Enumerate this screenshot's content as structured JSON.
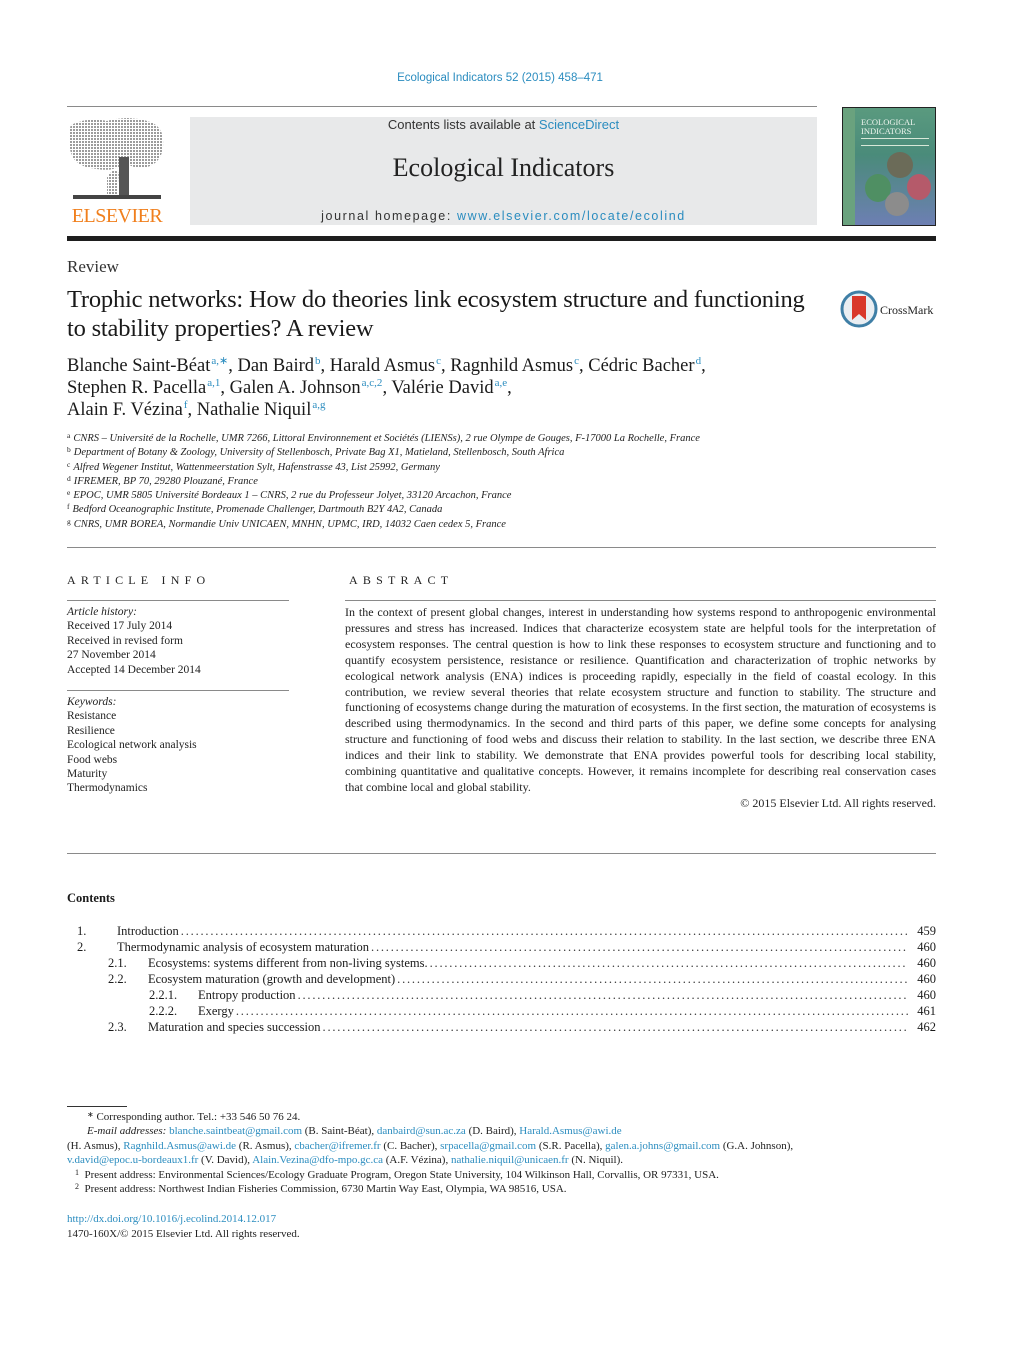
{
  "citation": "Ecological Indicators 52 (2015) 458–471",
  "publisher": {
    "name": "ELSEVIER",
    "brand_color": "#f07f1d"
  },
  "masthead": {
    "contents_prefix": "Contents lists available at ",
    "contents_link": "ScienceDirect",
    "journal_title": "Ecological Indicators",
    "homepage_prefix": "journal homepage: ",
    "homepage_link": "www.elsevier.com/locate/ecolind"
  },
  "cover": {
    "title_line1": "ECOLOGICAL",
    "title_line2": "INDICATORS"
  },
  "crossmark": {
    "label": "CrossMark"
  },
  "article": {
    "type": "Review",
    "title": "Trophic networks: How do theories link ecosystem structure and functioning to stability properties? A review",
    "authors": [
      {
        "name": "Blanche Saint-Béat",
        "sup": "a,∗",
        "sep": ", "
      },
      {
        "name": "Dan Baird",
        "sup": "b",
        "sep": ", "
      },
      {
        "name": "Harald Asmus",
        "sup": "c",
        "sep": ", "
      },
      {
        "name": "Ragnhild Asmus",
        "sup": "c",
        "sep": ", "
      },
      {
        "name": "Cédric Bacher",
        "sup": "d",
        "sep": ","
      },
      {
        "name": "Stephen R. Pacella",
        "sup": "a,1",
        "sep": ", "
      },
      {
        "name": "Galen A. Johnson",
        "sup": "a,c,2",
        "sep": ", "
      },
      {
        "name": "Valérie David",
        "sup": "a,e",
        "sep": ","
      },
      {
        "name": "Alain F. Vézina",
        "sup": "f",
        "sep": ", "
      },
      {
        "name": "Nathalie Niquil",
        "sup": "a,g",
        "sep": ""
      }
    ],
    "affiliations": [
      {
        "key": "a",
        "text": "CNRS – Université de la Rochelle, UMR 7266, Littoral Environnement et Sociétés (LIENSs), 2 rue Olympe de Gouges, F-17000 La Rochelle, France"
      },
      {
        "key": "b",
        "text": "Department of Botany & Zoology, University of Stellenbosch, Private Bag X1, Matieland, Stellenbosch, South Africa"
      },
      {
        "key": "c",
        "text": "Alfred Wegener Institut, Wattenmeerstation Sylt, Hafenstrasse 43, List 25992, Germany"
      },
      {
        "key": "d",
        "text": "IFREMER, BP 70, 29280 Plouzané, France"
      },
      {
        "key": "e",
        "text": "EPOC, UMR 5805 Université Bordeaux 1 – CNRS, 2 rue du Professeur Jolyet, 33120 Arcachon, France"
      },
      {
        "key": "f",
        "text": "Bedford Oceanographic Institute, Promenade Challenger, Dartmouth B2Y 4A2, Canada"
      },
      {
        "key": "g",
        "text": "CNRS, UMR BOREA, Normandie Univ UNICAEN, MNHN, UPMC, IRD, 14032 Caen cedex 5, France"
      }
    ]
  },
  "article_info": {
    "heading": "ARTICLE INFO",
    "history_label": "Article history:",
    "history": [
      "Received 17 July 2014",
      "Received in revised form",
      "27 November 2014",
      "Accepted 14 December 2014"
    ],
    "keywords_label": "Keywords:",
    "keywords": [
      "Resistance",
      "Resilience",
      "Ecological network analysis",
      "Food webs",
      "Maturity",
      "Thermodynamics"
    ]
  },
  "abstract": {
    "heading": "ABSTRACT",
    "text": "In the context of present global changes, interest in understanding how systems respond to anthropogenic environmental pressures and stress has increased. Indices that characterize ecosystem state are helpful tools for the interpretation of ecosystem responses. The central question is how to link these responses to ecosystem structure and functioning and to quantify ecosystem persistence, resistance or resilience. Quantification and characterization of trophic networks by ecological network analysis (ENA) indices is proceeding rapidly, especially in the field of coastal ecology. In this contribution, we review several theories that relate ecosystem structure and function to stability. The structure and functioning of ecosys­tems change during the maturation of ecosystems. In the first section, the maturation of ecosystems is described using thermodynamics. In the second and third parts of this paper, we define some concepts for analysing structure and functioning of food webs and discuss their relation to stability. In the last section, we describe three ENA indices and their link to stability. We demonstrate that ENA provides powerful tools for describing local stability, combining quantitative and qualitative concepts. However, it remains incomplete for describing real conservation cases that combine local and global stability.",
    "copyright": "© 2015 Elsevier Ltd. All rights reserved."
  },
  "contents": {
    "heading": "Contents",
    "items": [
      {
        "level": 1,
        "num": "1.",
        "label": "Introduction",
        "page": "459"
      },
      {
        "level": 1,
        "num": "2.",
        "label": "Thermodynamic analysis of ecosystem maturation",
        "page": "460"
      },
      {
        "level": 2,
        "num": "2.1.",
        "label": "Ecosystems: systems different from non-living systems.",
        "page": "460"
      },
      {
        "level": 2,
        "num": "2.2.",
        "label": "Ecosystem maturation (growth and development)",
        "page": "460"
      },
      {
        "level": 3,
        "num": "2.2.1.",
        "label": "Entropy production",
        "page": "460"
      },
      {
        "level": 3,
        "num": "2.2.2.",
        "label": "Exergy",
        "page": "461"
      },
      {
        "level": 2,
        "num": "2.3.",
        "label": "Maturation and species succession",
        "page": "462"
      }
    ]
  },
  "footnotes": {
    "corresponding_mark": "∗",
    "corresponding": "Corresponding author. Tel.: +33 546 50 76 24.",
    "email_label": "E-mail addresses:",
    "emails": [
      {
        "email": "blanche.saintbeat@gmail.com",
        "who": "(B. Saint-Béat)"
      },
      {
        "email": "danbaird@sun.ac.za",
        "who": "(D. Baird)"
      },
      {
        "email": "Harald.Asmus@awi.de",
        "who": "(H. Asmus)"
      },
      {
        "email": "Ragnhild.Asmus@awi.de",
        "who": "(R. Asmus)"
      },
      {
        "email": "cbacher@ifremer.fr",
        "who": "(C. Bacher)"
      },
      {
        "email": "srpacella@gmail.com",
        "who": "(S.R. Pacella)"
      },
      {
        "email": "galen.a.johns@gmail.com",
        "who": "(G.A. Johnson)"
      },
      {
        "email": "v.david@epoc.u-bordeaux1.fr",
        "who": "(V. David)"
      },
      {
        "email": "Alain.Vezina@dfo-mpo.gc.ca",
        "who": "(A.F. Vézina)"
      },
      {
        "email": "nathalie.niquil@unicaen.fr",
        "who": "(N. Niquil)."
      }
    ],
    "present_1_mark": "1",
    "present_1": "Present address: Environmental Sciences/Ecology Graduate Program, Oregon State University, 104 Wilkinson Hall, Corvallis, OR 97331, USA.",
    "present_2_mark": "2",
    "present_2": "Present address: Northwest Indian Fisheries Commission, 6730 Martin Way East, Olympia, WA 98516, USA."
  },
  "doi": {
    "link": "http://dx.doi.org/10.1016/j.ecolind.2014.12.017",
    "issn_line": "1470-160X/© 2015 Elsevier Ltd. All rights reserved."
  }
}
